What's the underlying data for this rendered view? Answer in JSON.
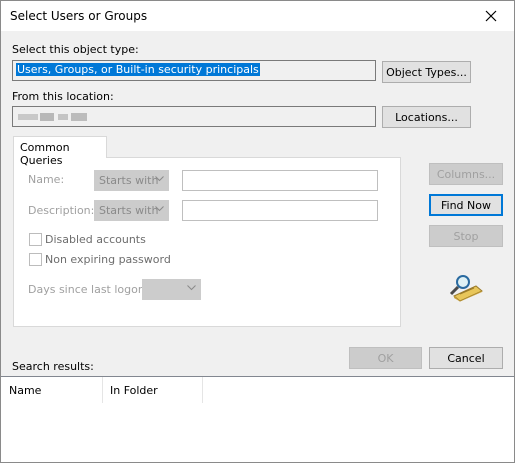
{
  "window": {
    "title": "Select Users or Groups"
  },
  "object_type": {
    "label": "Select this object type:",
    "value": "Users, Groups, or Built-in security principals",
    "button": "Object Types..."
  },
  "location": {
    "label": "From this location:",
    "value": "",
    "button": "Locations..."
  },
  "tabs": [
    {
      "label": "Common Queries"
    }
  ],
  "query": {
    "name_label": "Name:",
    "name_mode": "Starts with",
    "description_label": "Description:",
    "description_mode": "Starts with",
    "disabled_accounts": "Disabled accounts",
    "non_expiring": "Non expiring password",
    "days_label": "Days since last logon:"
  },
  "side_buttons": {
    "columns": "Columns...",
    "find_now": "Find Now",
    "stop": "Stop"
  },
  "footer": {
    "search_results_label": "Search results:",
    "ok": "OK",
    "cancel": "Cancel"
  },
  "results_columns": [
    "Name",
    "In Folder"
  ],
  "colors": {
    "selection": "#0078d7",
    "disabled_text": "#a0a0a0",
    "dialog_bg": "#f0f0f0"
  }
}
